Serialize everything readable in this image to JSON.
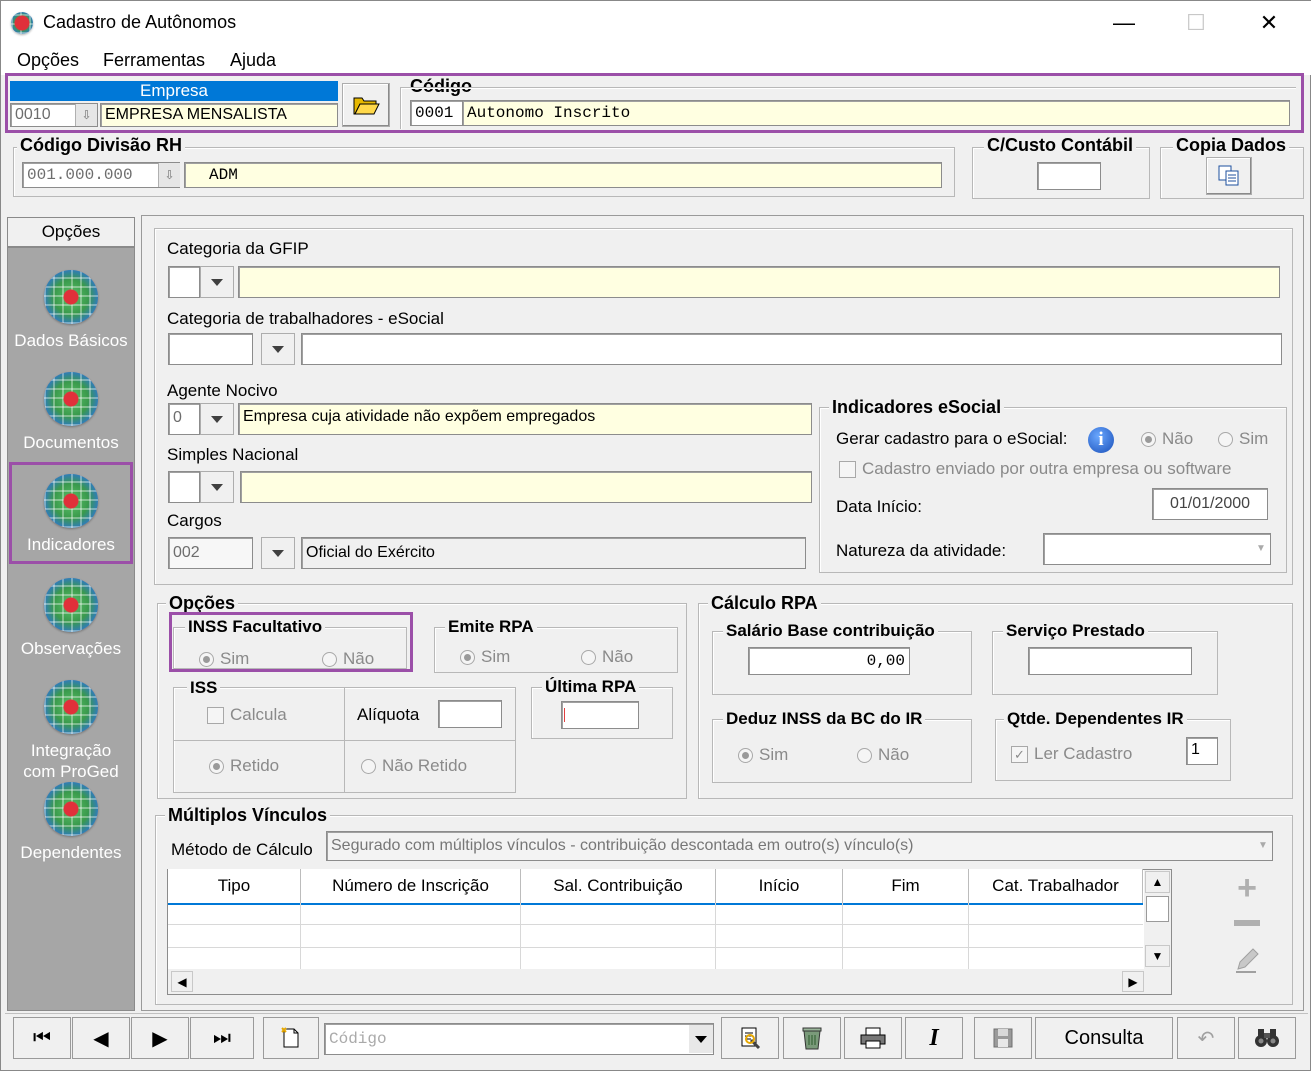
{
  "window": {
    "title": "Cadastro de Autônomos",
    "minimize": "—",
    "maximize": "☐",
    "close": "✕"
  },
  "menu": {
    "opcoes": "Opções",
    "ferramentas": "Ferramentas",
    "ajuda": "Ajuda"
  },
  "empresa": {
    "label": "Empresa",
    "code": "0010",
    "name": "EMPRESA MENSALISTA"
  },
  "codigo": {
    "label": "Código",
    "code": "0001",
    "name": "Autonomo  Inscrito"
  },
  "divisao": {
    "label": "Código Divisão RH",
    "code": "001.000.000",
    "name": "ADM"
  },
  "custo": {
    "label": "C/Custo Contábil",
    "value": ""
  },
  "copia": {
    "label": "Copia Dados"
  },
  "sidebar": {
    "header": "Opções",
    "items": [
      {
        "label": "Dados Básicos"
      },
      {
        "label": "Documentos"
      },
      {
        "label": "Indicadores"
      },
      {
        "label": "Observações"
      },
      {
        "label": "Integração com ProGed"
      },
      {
        "label": "Dependentes"
      }
    ]
  },
  "gfip": {
    "label": "Categoria da GFIP",
    "code": "",
    "desc": ""
  },
  "esocial_cat": {
    "label": "Categoria de trabalhadores - eSocial",
    "code": "",
    "desc": ""
  },
  "agente": {
    "label": "Agente  Nocivo",
    "code": "0",
    "desc": "Empresa cuja atividade não expõem empregados"
  },
  "simples": {
    "label": "Simples Nacional",
    "code": "",
    "desc": ""
  },
  "cargos": {
    "label": "Cargos",
    "code": "002",
    "desc": "Oficial do Exército"
  },
  "indicadores_esocial": {
    "title": "Indicadores eSocial",
    "gerar_label": "Gerar cadastro para o eSocial:",
    "nao": "Não",
    "sim": "Sim",
    "enviado_label": "Cadastro enviado por outra empresa ou software",
    "data_inicio_label": "Data Início:",
    "data_inicio": "01/01/2000",
    "natureza_label": "Natureza da atividade:",
    "natureza": ""
  },
  "opcoes": {
    "title": "Opções",
    "inss_title": "INSS Facultativo",
    "sim": "Sim",
    "nao": "Não",
    "rpa_title": "Emite RPA",
    "iss_title": "ISS",
    "calcula": "Calcula",
    "aliquota_label": "Alíquota",
    "aliquota": "",
    "retido": "Retido",
    "nao_retido": "Não Retido",
    "ultima_rpa_title": "Última RPA",
    "ultima_rpa": ""
  },
  "calculo_rpa": {
    "title": "Cálculo RPA",
    "salario_title": "Salário Base contribuição",
    "salario": "0,00",
    "servico_title": "Serviço Prestado",
    "servico": "",
    "deduz_title": "Deduz INSS da BC do IR",
    "sim": "Sim",
    "nao": "Não",
    "qtde_title": "Qtde. Dependentes IR",
    "ler_cadastro": "Ler Cadastro",
    "qtde": "1"
  },
  "multiplos": {
    "title": "Múltiplos Vínculos",
    "metodo_label": "Método de Cálculo",
    "metodo": "Segurado com múltiplos vínculos - contribuição descontada em outro(s) vínculo(s)",
    "columns": [
      "Tipo",
      "Número de Inscrição",
      "Sal. Contribuição",
      "Início",
      "Fim",
      "Cat. Trabalhador"
    ]
  },
  "toolbar": {
    "codigo_placeholder": "Código",
    "consulta": "Consulta"
  },
  "colors": {
    "highlight": "#9b4fa8",
    "header_blue": "#0078d7",
    "readonly_yellow": "#ffffe1"
  }
}
